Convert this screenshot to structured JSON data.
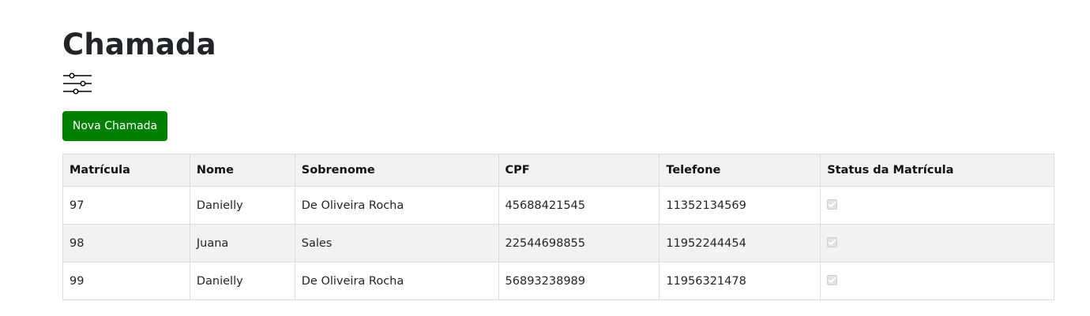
{
  "page": {
    "title": "Chamada",
    "new_button_label": "Nova Chamada"
  },
  "icons": {
    "filter": "sliders-icon"
  },
  "colors": {
    "button_bg": "#008000",
    "header_row_bg": "#f2f2f2",
    "stripe_bg": "#f2f2f2"
  },
  "table": {
    "headers": [
      "Matrícula",
      "Nome",
      "Sobrenome",
      "CPF",
      "Telefone",
      "Status da Matrícula"
    ],
    "rows": [
      {
        "matricula": "97",
        "nome": "Danielly",
        "sobrenome": "De Oliveira Rocha",
        "cpf": "45688421545",
        "telefone": "11352134569",
        "status_checked": true
      },
      {
        "matricula": "98",
        "nome": "Juana",
        "sobrenome": "Sales",
        "cpf": "22544698855",
        "telefone": "11952244454",
        "status_checked": true
      },
      {
        "matricula": "99",
        "nome": "Danielly",
        "sobrenome": "De Oliveira Rocha",
        "cpf": "56893238989",
        "telefone": "11956321478",
        "status_checked": true
      }
    ]
  }
}
